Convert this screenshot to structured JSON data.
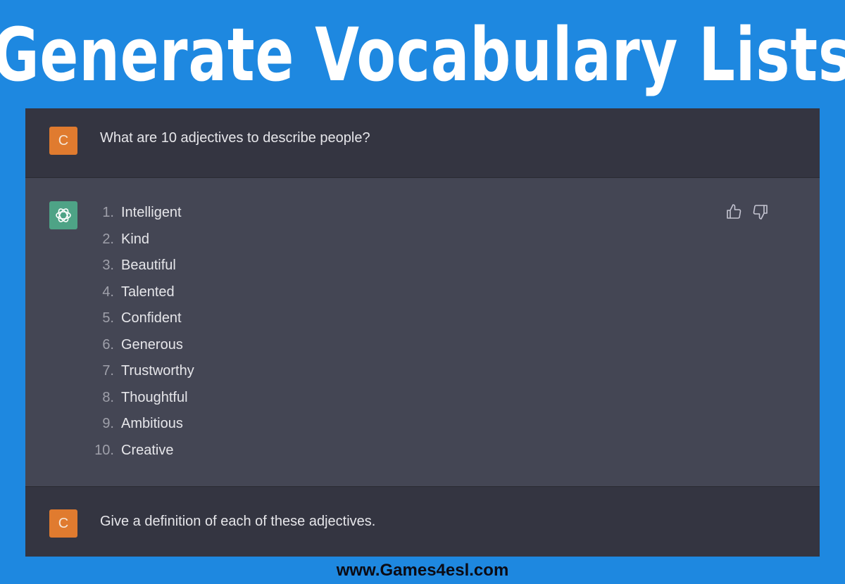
{
  "banner": {
    "title": "Generate Vocabulary Lists"
  },
  "conversation": {
    "first_user_message": {
      "avatar_letter": "C",
      "text": "What are 10 adjectives to describe people?"
    },
    "assistant_message": {
      "avatar_icon": "openai-logo-icon",
      "items": [
        {
          "number": "1.",
          "word": "Intelligent"
        },
        {
          "number": "2.",
          "word": "Kind"
        },
        {
          "number": "3.",
          "word": "Beautiful"
        },
        {
          "number": "4.",
          "word": "Talented"
        },
        {
          "number": "5.",
          "word": "Confident"
        },
        {
          "number": "6.",
          "word": "Generous"
        },
        {
          "number": "7.",
          "word": "Trustworthy"
        },
        {
          "number": "8.",
          "word": "Thoughtful"
        },
        {
          "number": "9.",
          "word": "Ambitious"
        },
        {
          "number": "10.",
          "word": "Creative"
        }
      ],
      "feedback": {
        "thumbs_up": "thumbs-up-icon",
        "thumbs_down": "thumbs-down-icon"
      }
    },
    "second_user_message": {
      "avatar_letter": "C",
      "text": "Give a definition of each of these adjectives."
    }
  },
  "footer": {
    "url": "www.Games4esl.com"
  },
  "colors": {
    "banner_bg": "#1e88e0",
    "user_bg": "#343541",
    "assistant_bg": "#444654",
    "user_avatar": "#e07b2f",
    "bot_avatar": "#4ea386"
  }
}
